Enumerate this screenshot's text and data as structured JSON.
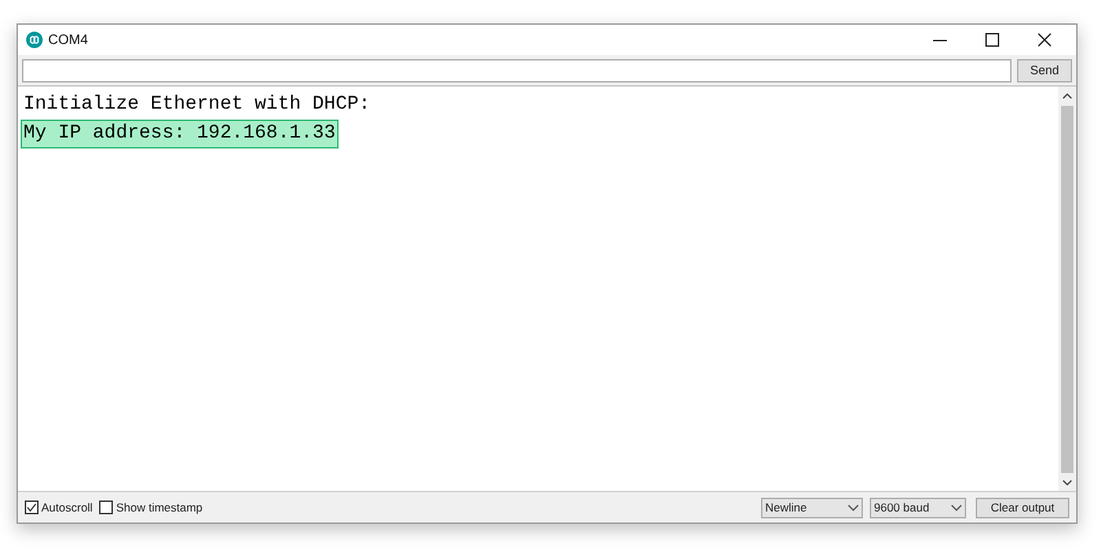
{
  "window": {
    "title": "COM4"
  },
  "input": {
    "button": "Send"
  },
  "output": {
    "lines": [
      {
        "text": "Initialize Ethernet with DHCP:",
        "highlighted": false
      },
      {
        "text": "My IP address: 192.168.1.33",
        "highlighted": true
      }
    ]
  },
  "footer": {
    "checkboxes": [
      {
        "label": "Autoscroll",
        "checked": true
      },
      {
        "label": "Show timestamp",
        "checked": false
      }
    ],
    "line_ending": "Newline",
    "baud": "9600 baud",
    "clear_button": "Clear output"
  }
}
